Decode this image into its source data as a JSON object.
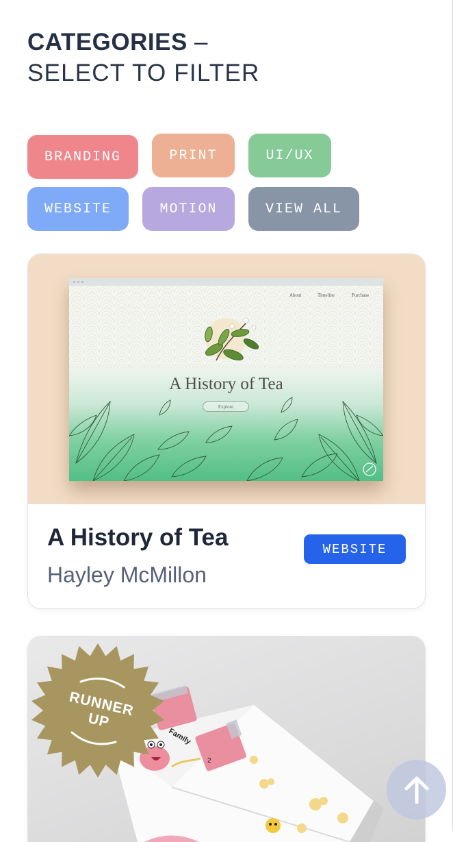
{
  "header": {
    "title_bold": "CATEGORIES",
    "title_dash": " –",
    "subtitle": "SELECT TO FILTER"
  },
  "filters": [
    {
      "label": "BRANDING",
      "color": "#ee868c"
    },
    {
      "label": "PRINT",
      "color": "#eeb094"
    },
    {
      "label": "UI/UX",
      "color": "#86cb97"
    },
    {
      "label": "WEBSITE",
      "color": "#7faaf7"
    },
    {
      "label": "MOTION",
      "color": "#b8a8e0"
    },
    {
      "label": "VIEW ALL",
      "color": "#8895a7"
    }
  ],
  "projects": [
    {
      "title": "A History of Tea",
      "author": "Hayley McMillon",
      "category": "WEBSITE",
      "category_color": "#2563eb",
      "thumbnail": {
        "nav": [
          "About",
          "Timeline",
          "Purchase"
        ],
        "heading": "A History of Tea",
        "button": "Explore"
      }
    },
    {
      "badge": "RUNNER\nUP",
      "badge_line1": "RUNNER",
      "badge_line2": "UP",
      "badge_color": "#a89660",
      "thumbnail_text": {
        "word": "Family",
        "number": "2"
      }
    }
  ],
  "scroll_top": {
    "icon": "arrow-up-icon"
  }
}
